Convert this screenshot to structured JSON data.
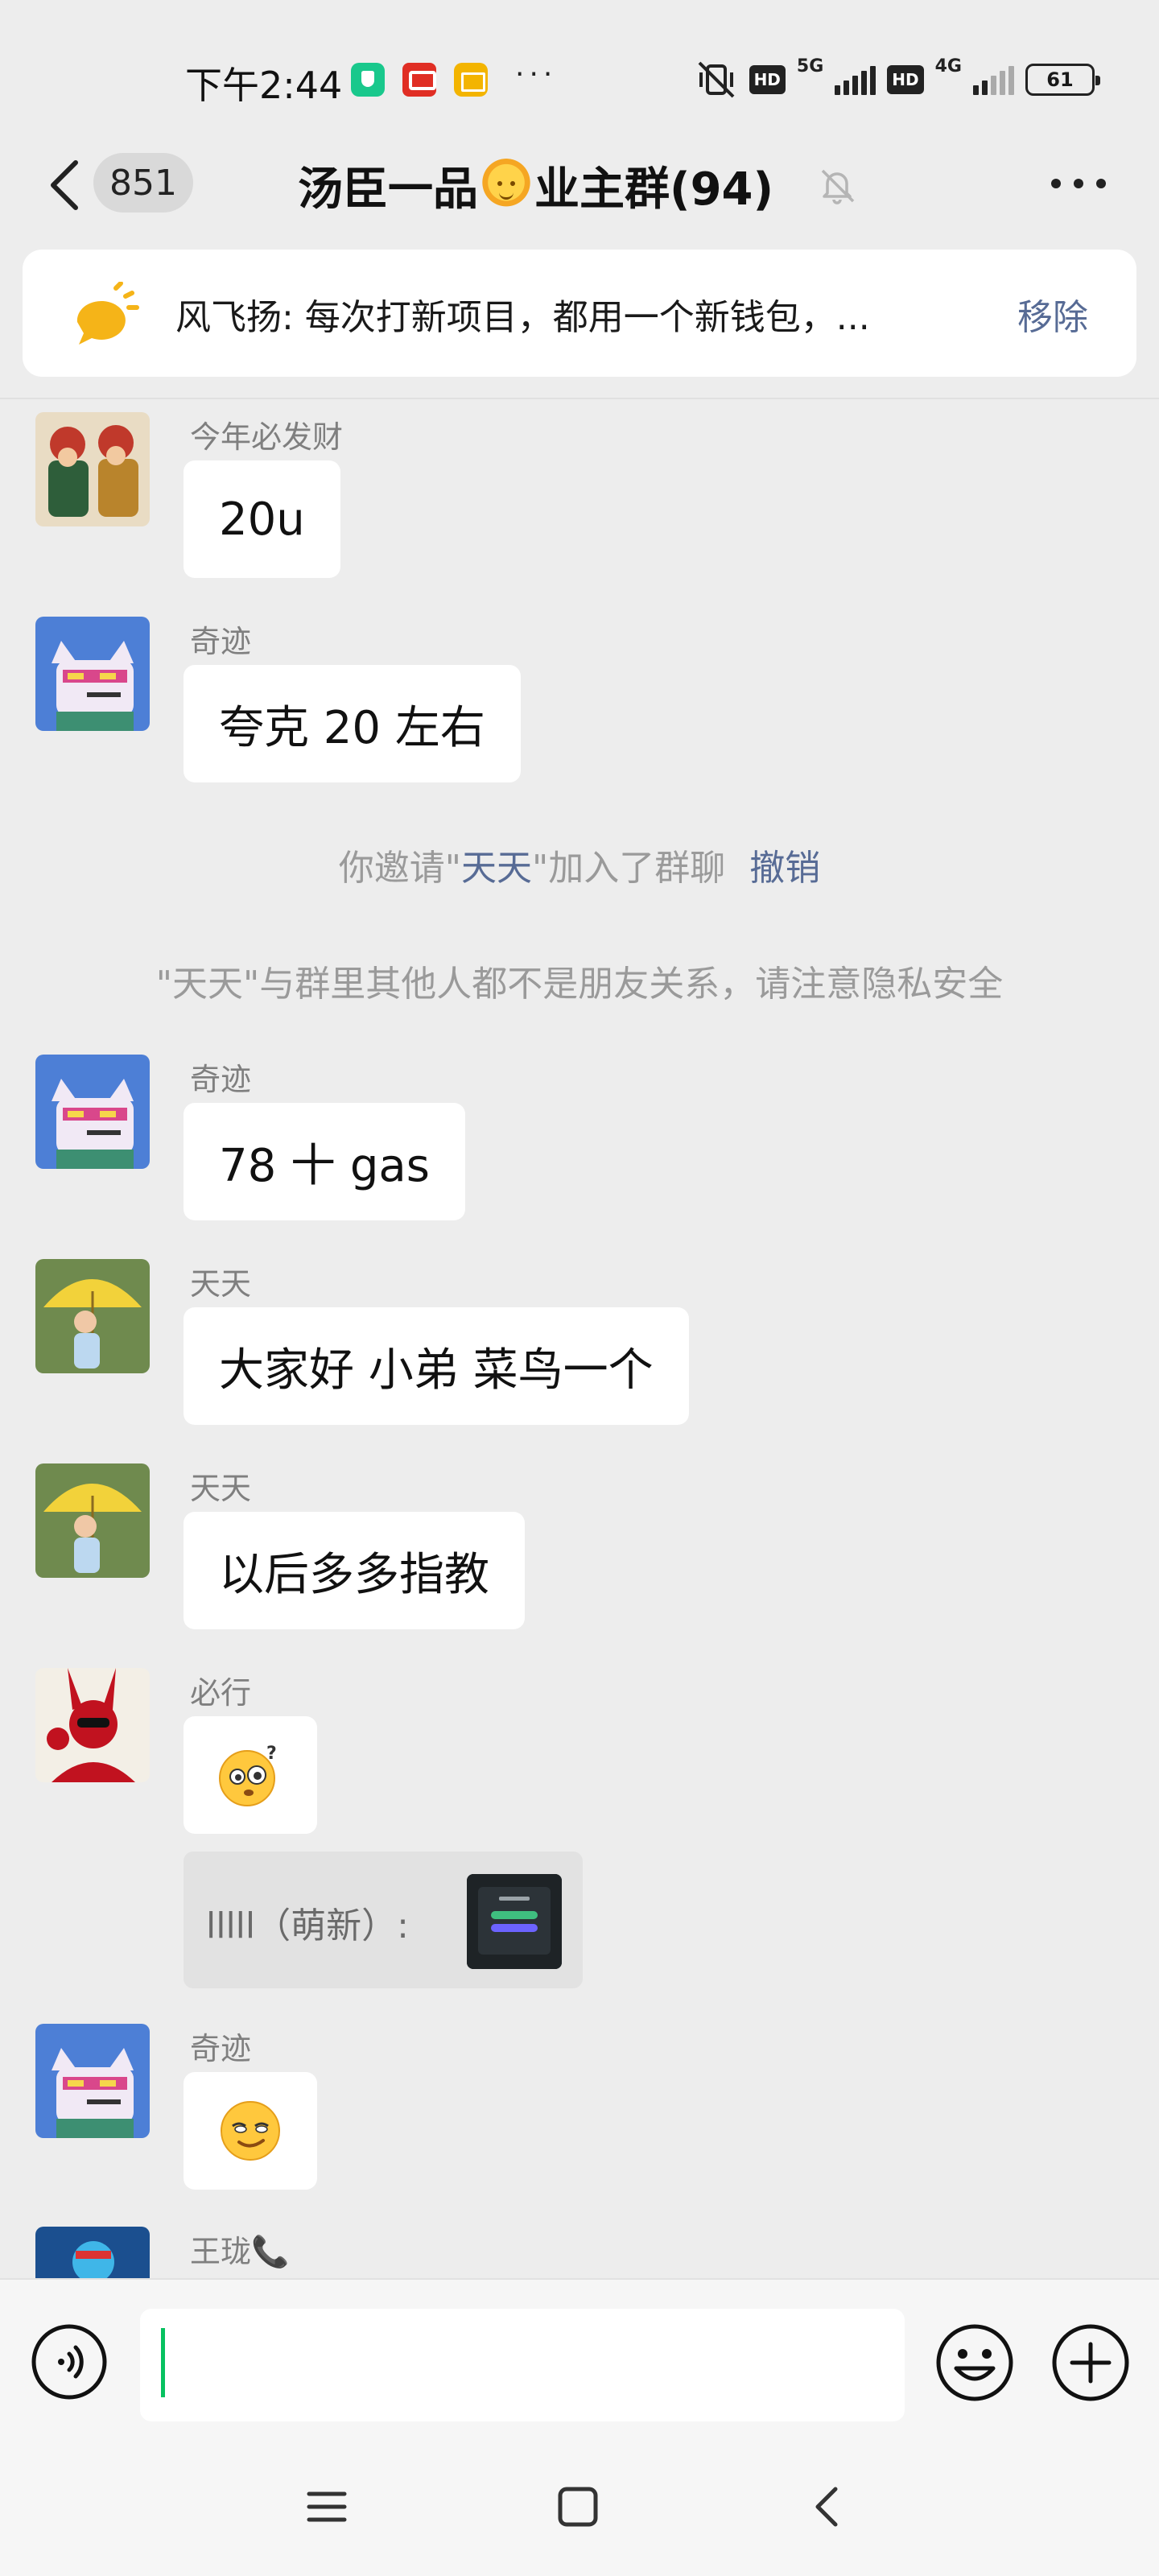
{
  "status_bar": {
    "time": "下午2:44",
    "hd1": "HD",
    "net1": "5G",
    "hd2": "HD",
    "net2": "4G",
    "battery": "61",
    "more_dots": "···"
  },
  "header": {
    "unread_count": "851",
    "title_before_emoji": "汤臣一品",
    "title_after_emoji": "业主群(94)",
    "emoji": "sun-face"
  },
  "pinned": {
    "text": "风飞扬: 每次打新项目，都用一个新钱包，...",
    "remove_label": "移除"
  },
  "messages": [
    {
      "sender": "今年必发财",
      "text": "20u",
      "avatar": "avatar-fortune-gods"
    },
    {
      "sender": "奇迹",
      "text": "夸克 20 左右",
      "avatar": "avatar-pixel-cat"
    },
    {
      "sender": "奇迹",
      "text": "78 十 gas",
      "avatar": "avatar-pixel-cat"
    },
    {
      "sender": "天天",
      "text": "大家好 小弟 菜鸟一个",
      "avatar": "avatar-umbrella-girl"
    },
    {
      "sender": "天天",
      "text": "以后多多指教",
      "avatar": "avatar-umbrella-girl"
    },
    {
      "sender": "必行",
      "text": "",
      "emoji": "confused-emoji",
      "avatar": "avatar-red-rabbit"
    },
    {
      "sender": "奇迹",
      "text": "",
      "emoji": "smirk-emoji",
      "avatar": "avatar-pixel-cat"
    },
    {
      "sender": "王珑📞",
      "text": "",
      "avatar": "avatar-blue-cartoon"
    }
  ],
  "system": {
    "invite_prefix": "你邀请\"",
    "invite_name": "天天",
    "invite_suffix": "\"加入了群聊",
    "undo_label": "撤销",
    "privacy_notice": "\"天天\"与群里其他人都不是朋友关系，请注意隐私安全"
  },
  "quote": {
    "text": "lllll（萌新）:"
  },
  "input": {
    "placeholder": ""
  },
  "colors": {
    "background": "#ededed",
    "link": "#576b95",
    "accent": "#07c160",
    "bubble": "#ffffff"
  }
}
